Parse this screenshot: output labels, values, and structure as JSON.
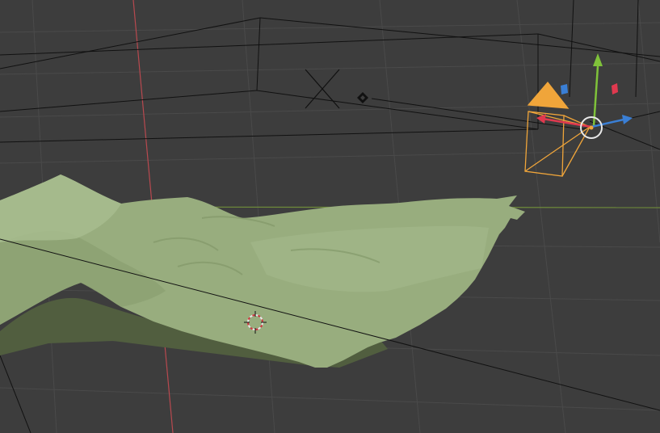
{
  "app": "3D Viewport",
  "colors": {
    "background": "#3d3d3d",
    "grid_line": "#4a4a4a",
    "grid_major": "#525252",
    "x_axis": "#b8494f",
    "y_axis": "#6f8c3a",
    "wire": "#111111",
    "mesh_light": "#a4b98a",
    "mesh_mid": "#8fa676",
    "mesh_dark": "#6e8056",
    "mesh_shadow": "#515e3f",
    "camera_selected": "#f0a53a",
    "gizmo_x": "#e0394f",
    "gizmo_y": "#7fc23a",
    "gizmo_z": "#3a7fd5"
  },
  "scene": {
    "objects": [
      {
        "name": "terrain-mesh",
        "icon": "mesh-object"
      },
      {
        "name": "camera",
        "icon": "camera-object",
        "selected": true
      },
      {
        "name": "light-empty",
        "icon": "empty-object"
      }
    ],
    "gizmo": {
      "mode": "translate",
      "axes": [
        "x",
        "y",
        "z"
      ]
    },
    "cursor": {
      "icon": "3d-cursor-icon"
    }
  }
}
